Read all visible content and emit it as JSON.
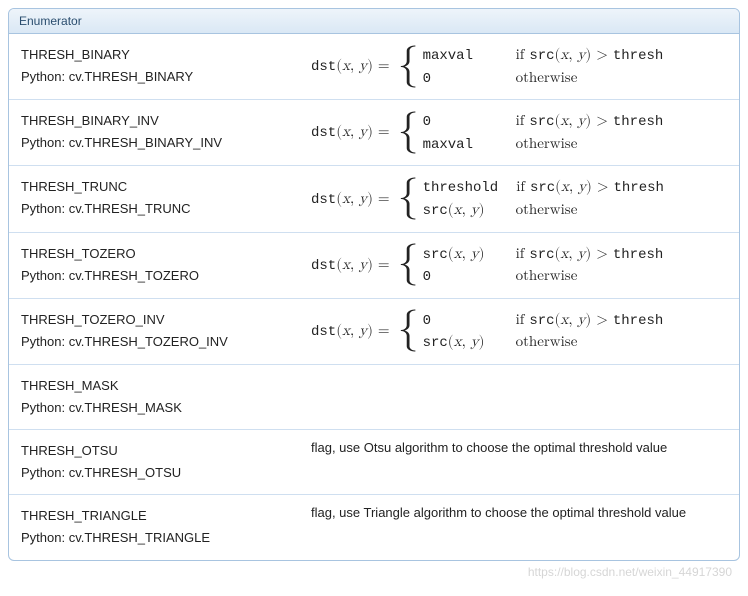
{
  "panel": {
    "title": "Enumerator"
  },
  "rows": [
    {
      "name": "THRESH_BINARY",
      "python": "Python: cv.THRESH_BINARY",
      "formula": {
        "lhs": "dst(x, y) = ",
        "cases": [
          {
            "value_tt": "maxval",
            "cond_prefix": "if ",
            "cond_src": "src(x, y)",
            "cond_op": " > ",
            "cond_rhs_tt": "thresh"
          },
          {
            "value_tt": "0",
            "cond_text": "otherwise"
          }
        ]
      }
    },
    {
      "name": "THRESH_BINARY_INV",
      "python": "Python: cv.THRESH_BINARY_INV",
      "formula": {
        "lhs": "dst(x, y) = ",
        "cases": [
          {
            "value_tt": "0",
            "cond_prefix": "if ",
            "cond_src": "src(x, y)",
            "cond_op": " > ",
            "cond_rhs_tt": "thresh"
          },
          {
            "value_tt": "maxval",
            "cond_text": "otherwise"
          }
        ]
      }
    },
    {
      "name": "THRESH_TRUNC",
      "python": "Python: cv.THRESH_TRUNC",
      "formula": {
        "lhs": "dst(x, y) = ",
        "cases": [
          {
            "value_tt": "threshold",
            "cond_prefix": "if ",
            "cond_src": "src(x, y)",
            "cond_op": " > ",
            "cond_rhs_tt": "thresh"
          },
          {
            "value_src": "src(x, y)",
            "cond_text": "otherwise"
          }
        ]
      }
    },
    {
      "name": "THRESH_TOZERO",
      "python": "Python: cv.THRESH_TOZERO",
      "formula": {
        "lhs": "dst(x, y) = ",
        "cases": [
          {
            "value_src": "src(x, y)",
            "cond_prefix": "if ",
            "cond_src": "src(x, y)",
            "cond_op": " > ",
            "cond_rhs_tt": "thresh"
          },
          {
            "value_tt": "0",
            "cond_text": "otherwise"
          }
        ]
      }
    },
    {
      "name": "THRESH_TOZERO_INV",
      "python": "Python: cv.THRESH_TOZERO_INV",
      "formula": {
        "lhs": "dst(x, y) = ",
        "cases": [
          {
            "value_tt": "0",
            "cond_prefix": "if ",
            "cond_src": "src(x, y)",
            "cond_op": " > ",
            "cond_rhs_tt": "thresh"
          },
          {
            "value_src": "src(x, y)",
            "cond_text": "otherwise"
          }
        ]
      }
    },
    {
      "name": "THRESH_MASK",
      "python": "Python: cv.THRESH_MASK",
      "text": ""
    },
    {
      "name": "THRESH_OTSU",
      "python": "Python: cv.THRESH_OTSU",
      "text": "flag, use Otsu algorithm to choose the optimal threshold value"
    },
    {
      "name": "THRESH_TRIANGLE",
      "python": "Python: cv.THRESH_TRIANGLE",
      "text": "flag, use Triangle algorithm to choose the optimal threshold value"
    }
  ],
  "watermark": "https://blog.csdn.net/weixin_44917390"
}
